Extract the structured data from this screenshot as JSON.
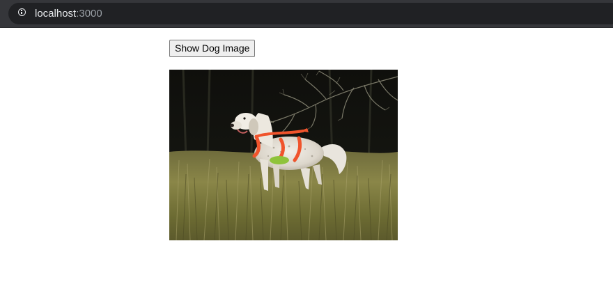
{
  "browser": {
    "url_host": "localhost",
    "url_port": ":3000",
    "info_icon": "info-icon"
  },
  "page": {
    "show_button_label": "Show Dog Image",
    "image_subject": "dog-photo"
  },
  "colors": {
    "browser_bar": "#35363a",
    "address_bar": "#202124",
    "button_bg": "#efefef",
    "button_border": "#767676"
  }
}
